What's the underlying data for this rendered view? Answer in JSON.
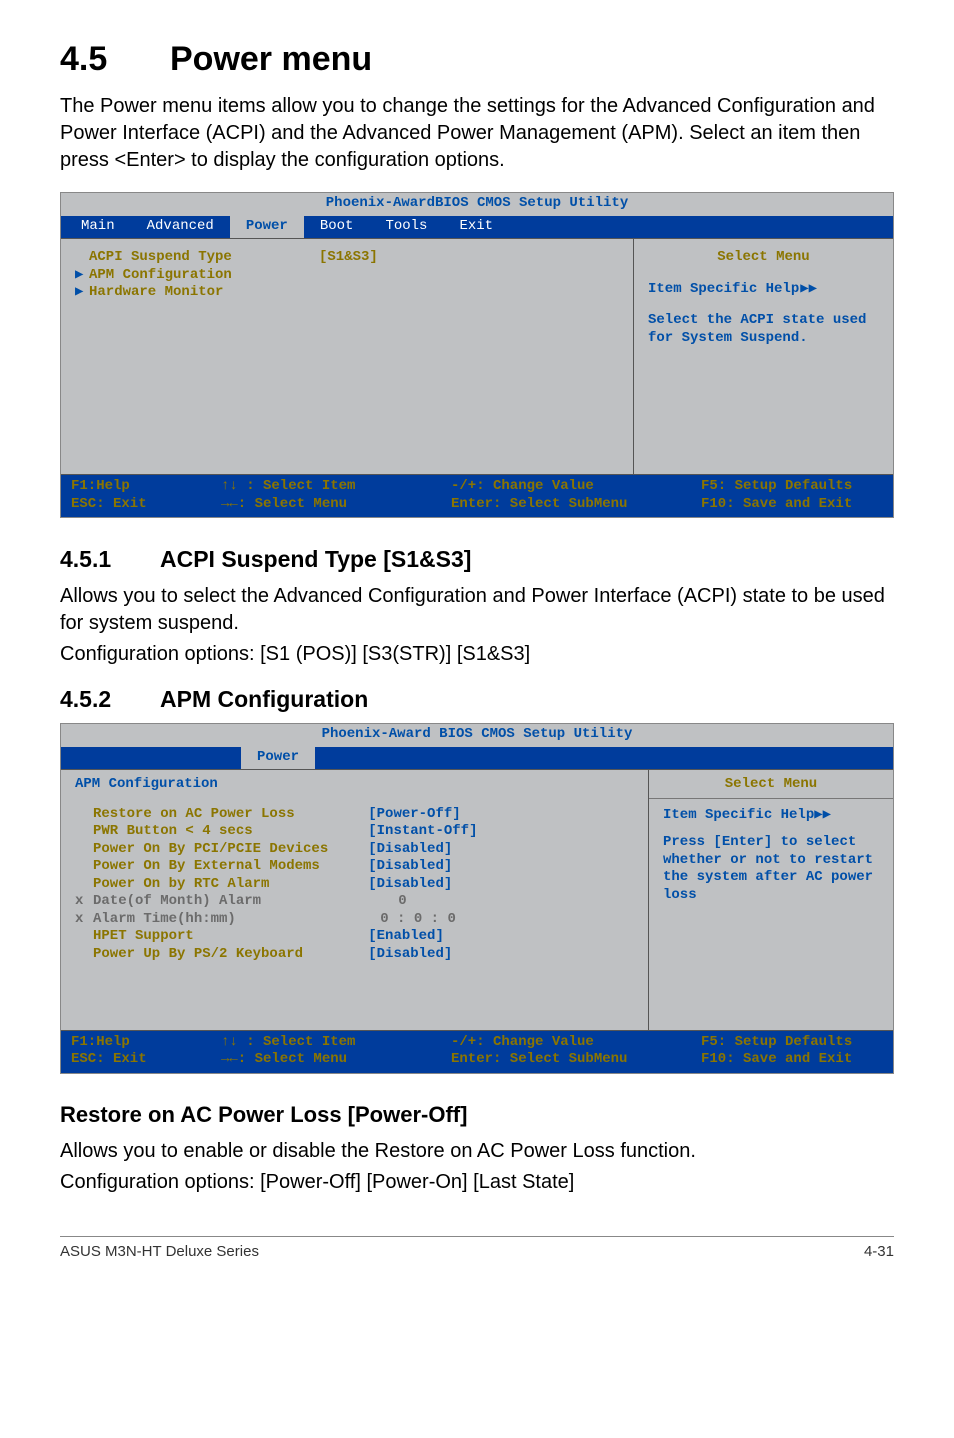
{
  "page": {
    "section_num": "4.5",
    "section_title": "Power menu",
    "section_intro": "The Power menu items allow you to change the settings for the Advanced Configuration and Power Interface (ACPI) and the Advanced Power Management (APM). Select an item then press <Enter> to display the configuration options."
  },
  "bios1": {
    "title": "Phoenix-AwardBIOS CMOS Setup Utility",
    "tabs": {
      "main": "Main",
      "advanced": "Advanced",
      "power": "Power",
      "boot": "Boot",
      "tools": "Tools",
      "exit": "Exit"
    },
    "items": [
      {
        "caret": "",
        "label": "ACPI Suspend Type",
        "value": "[S1&S3]"
      },
      {
        "caret": "▶",
        "label": "APM Configuration",
        "value": ""
      },
      {
        "caret": "▶",
        "label": "Hardware Monitor",
        "value": ""
      }
    ],
    "help": {
      "select_menu": "Select Menu",
      "specific": "Item Specific Help",
      "arrows": "▶▶",
      "desc": "Select the ACPI state used for System Suspend."
    },
    "footer": {
      "f1": "F1:Help",
      "esc": "ESC: Exit",
      "sel_item": "↑↓ : Select Item",
      "sel_menu": "→←: Select Menu",
      "change": "-/+: Change Value",
      "enter": "Enter: Select SubMenu",
      "f5": "F5: Setup Defaults",
      "f10": "F10: Save and Exit"
    }
  },
  "sec451": {
    "num": "4.5.1",
    "title": "ACPI Suspend Type [S1&S3]",
    "p1": "Allows you to select the Advanced Configuration and Power Interface (ACPI) state to be used for system suspend.",
    "p2": "Configuration options: [S1 (POS)] [S3(STR)] [S1&S3]"
  },
  "sec452": {
    "num": "4.5.2",
    "title": "APM Configuration"
  },
  "bios2": {
    "title": "Phoenix-Award BIOS CMOS Setup Utility",
    "power_tab": "Power",
    "subtitle": "APM Configuration",
    "items": [
      {
        "caret": "",
        "label": "Restore on AC Power Loss",
        "value": "[Power-Off]",
        "grey": false
      },
      {
        "caret": "",
        "label": "PWR Button < 4 secs",
        "value": "[Instant-Off]",
        "grey": false
      },
      {
        "caret": "",
        "label": "Power On By PCI/PCIE Devices",
        "value": "[Disabled]",
        "grey": false
      },
      {
        "caret": "",
        "label": "Power On By External Modems",
        "value": "[Disabled]",
        "grey": false
      },
      {
        "caret": "",
        "label": "Power On by RTC Alarm",
        "value": "[Disabled]",
        "grey": false
      },
      {
        "caret": "x",
        "label": "Date(of Month) Alarm",
        "value": "0",
        "grey": true
      },
      {
        "caret": "x",
        "label": "Alarm Time(hh:mm)",
        "value": "0 : 0 : 0",
        "grey": true
      },
      {
        "caret": "",
        "label": "HPET Support",
        "value": "[Enabled]",
        "grey": false
      },
      {
        "caret": "",
        "label": "Power Up By PS/2 Keyboard",
        "value": "[Disabled]",
        "grey": false
      }
    ],
    "help": {
      "select_menu": "Select Menu",
      "specific": "Item Specific Help",
      "arrows": "▶▶",
      "desc_line1": "Press",
      "desc_key": " [Enter] ",
      "desc_line2": "to select whether or not to restart the system after AC power loss"
    },
    "footer": {
      "f1": "F1:Help",
      "esc": "ESC: Exit",
      "sel_item": "↑↓ : Select Item",
      "sel_menu": "→←: Select Menu",
      "change": "-/+: Change Value",
      "enter": "Enter: Select SubMenu",
      "f5": "F5: Setup Defaults",
      "f10": "F10: Save and Exit"
    }
  },
  "restore": {
    "title": "Restore on AC Power Loss [Power-Off]",
    "p1": "Allows you to enable or disable the Restore on AC Power Loss function.",
    "p2": "Configuration options: [Power-Off] [Power-On] [Last State]"
  },
  "footerbar": {
    "product": "ASUS M3N-HT Deluxe Series",
    "pageno": "4-31"
  }
}
